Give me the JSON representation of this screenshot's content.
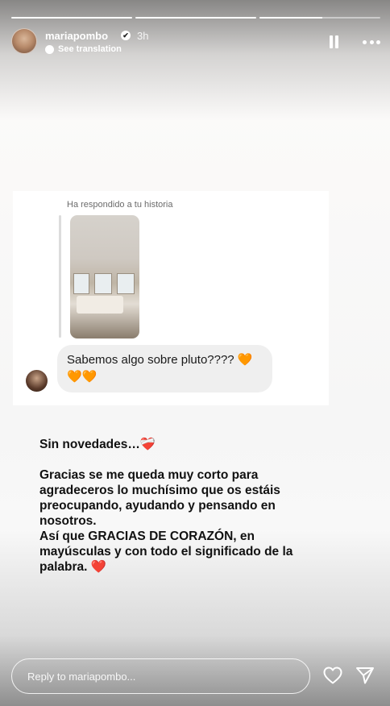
{
  "story": {
    "progress": [
      1,
      1,
      0.52
    ],
    "username": "mariapombo",
    "verified_mark": "✔",
    "time_ago": "3h",
    "translate_label": "See translation"
  },
  "dm": {
    "replied_label": "Ha respondido a tu historia",
    "message": "Sabemos algo sobre pluto???? 🧡🧡🧡"
  },
  "caption": {
    "title": "Sin novedades…❤️‍🩹",
    "body": "Gracias se me queda muy corto para agradeceros lo muchísimo que os estáis preocupando, ayudando y pensando en nosotros.\nAsí que GRACIAS DE CORAZÓN, en mayúsculas y con todo el significado de la palabra. ❤️"
  },
  "footer": {
    "reply_placeholder": "Reply to mariapombo..."
  },
  "icons": [
    "verified-icon",
    "translate-icon",
    "pause-icon",
    "more-icon",
    "heart-icon",
    "send-icon"
  ]
}
